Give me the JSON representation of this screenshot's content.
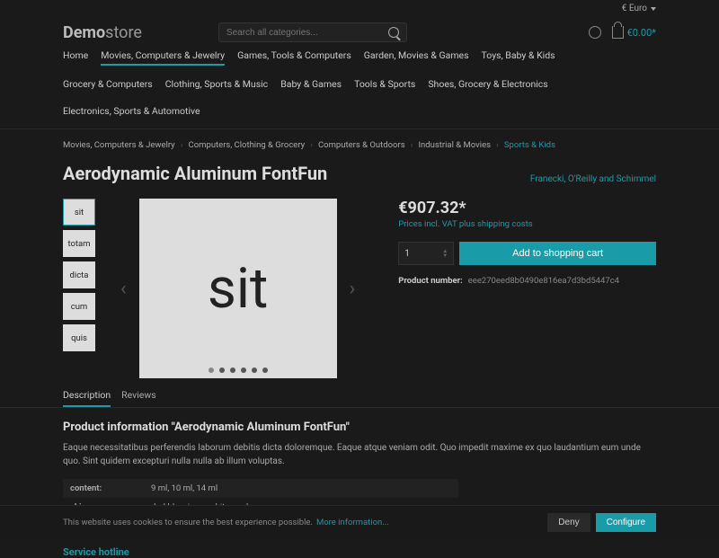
{
  "topbar": {
    "currency": "€ Euro"
  },
  "logo": {
    "a": "Demo",
    "b": "store"
  },
  "search": {
    "placeholder": "Search all categories..."
  },
  "cart": {
    "total": "€0.00*"
  },
  "nav": [
    "Home",
    "Movies, Computers & Jewelry",
    "Games, Tools & Computers",
    "Garden, Movies & Games",
    "Toys, Baby & Kids",
    "Grocery & Computers",
    "Clothing, Sports & Music",
    "Baby & Games",
    "Tools & Sports",
    "Shoes, Grocery & Electronics",
    "Electronics, Sports & Automotive"
  ],
  "nav_active": 1,
  "crumbs": [
    "Movies, Computers & Jewelry",
    "Computers, Clothing & Grocery",
    "Computers & Outdoors",
    "Industrial & Movies",
    "Sports & Kids"
  ],
  "product": {
    "title": "Aerodynamic Aluminum FontFun",
    "manufacturer": "Franecki, O'Reilly and Schimmel",
    "thumbs": [
      "sit",
      "totam",
      "dicta",
      "cum",
      "quis"
    ],
    "main_image": "sit",
    "dots": 6,
    "price": "€907.32*",
    "vat": "Prices incl. VAT plus shipping costs",
    "qty": "1",
    "add_label": "Add to shopping cart",
    "pn_label": "Product number:",
    "pn_value": "eee270eed8b0490e816ea7d3bd5447c4"
  },
  "tabs": [
    "Description",
    "Reviews"
  ],
  "desc": {
    "heading": "Product information \"Aerodynamic Aluminum FontFun\"",
    "text": "Eaque necessitatibus perferendis laborum debitis dicta doloremque. Eaque atque veniam odit. Quo impedit maxime ex quo laudantium eum unde quo. Sint quidem excepturi nulla nulla ab illum voluptas.",
    "props": [
      {
        "k": "content:",
        "v": "9 ml, 10 ml, 14 ml"
      },
      {
        "k": "skin:",
        "v": "darkblue, ivory, whitesmoke"
      }
    ]
  },
  "footer": {
    "hotline": "Service hotline"
  },
  "cookie": {
    "text": "This website uses cookies to ensure the best experience possible.",
    "more": "More information...",
    "deny": "Deny",
    "conf": "Configure"
  }
}
